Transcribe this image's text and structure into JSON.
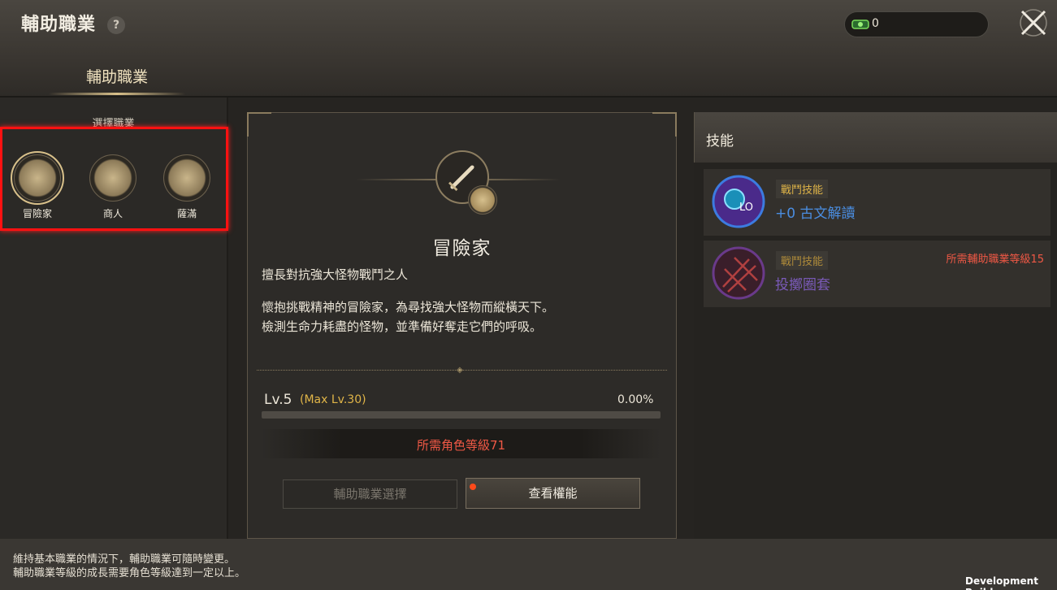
{
  "header": {
    "title": "輔助職業",
    "help_icon": "?",
    "currency_icon": "green-gem-icon",
    "currency_value": "0",
    "close_icon": "close-icon"
  },
  "tabs": [
    {
      "label": "輔助職業",
      "active": true
    }
  ],
  "left": {
    "section_label": "選擇職業",
    "jobs": [
      {
        "label": "冒險家",
        "icon": "compass-icon",
        "selected": true
      },
      {
        "label": "商人",
        "icon": "coin-stack-icon",
        "selected": false
      },
      {
        "label": "薩滿",
        "icon": "totem-mask-icon",
        "selected": false
      }
    ]
  },
  "detail": {
    "emblem_icon": "dagger-icon",
    "badge_icon": "compass-icon",
    "name": "冒險家",
    "tagline": "擅長對抗強大怪物戰鬥之人",
    "desc_line1": "懷抱挑戰精神的冒險家，為尋找強大怪物而縱橫天下。",
    "desc_line2": "檢測生命力耗盡的怪物，並準備好奪走它們的呼吸。",
    "level": "Lv.5",
    "max_level": "(Max Lv.30)",
    "exp_percent": "0.00%",
    "exp_fraction": 0.0,
    "requirement": "所需角色等級71",
    "btn_select": "輔助職業選擇",
    "btn_view": "查看權能"
  },
  "skills": {
    "title": "技能",
    "items": [
      {
        "tag": "戰鬥技能",
        "name": "+0 古文解讀",
        "requirement": "",
        "icon": "ancient-text-icon",
        "unlocked": true
      },
      {
        "tag": "戰鬥技能",
        "name": "投擲圈套",
        "requirement": "所需輔助職業等級15",
        "icon": "net-trap-icon",
        "unlocked": false
      }
    ]
  },
  "footer": {
    "line1": "維持基本職業的情況下，輔助職業可隨時變更。",
    "line2": "輔助職業等級的成長需要角色等級達到一定以上。"
  },
  "build_label": "Development Build",
  "colors": {
    "highlight": "#ff1111",
    "gold": "#e0b548",
    "warning": "#ef5845",
    "skill_blue": "#4a8de0",
    "skill_purple": "#7a5ab8"
  }
}
